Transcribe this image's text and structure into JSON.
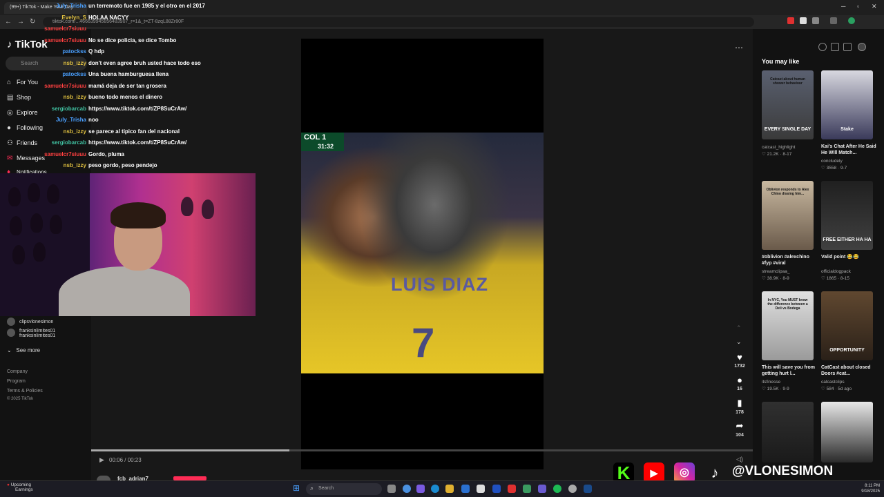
{
  "browser": {
    "tab_title": "(99+) TikTok - Make Your Day",
    "url": "tiktok.com/@...?is_from_webapp=1&sender_device=pc&web_id=7543663994585648390?_r=1&_t=ZT-8zqL8BZr80F",
    "url_short": "tiktok.com/...466639945856483907_r=1&_t=ZT-8zqL88Zr80F"
  },
  "sidebar": {
    "logo": "TikTok",
    "search_placeholder": "Search",
    "nav": [
      {
        "label": "For You"
      },
      {
        "label": "Shop"
      },
      {
        "label": "Explore"
      },
      {
        "label": "Following"
      },
      {
        "label": "Friends"
      },
      {
        "label": "Messages"
      },
      {
        "label": "Notifications"
      }
    ],
    "accounts": [
      {
        "name": "clipsvlonesimon",
        "sub": ""
      },
      {
        "name": "franksinlimites01",
        "sub": "franksinlimites01"
      }
    ],
    "see_more": "See more",
    "footer": [
      "Company",
      "Program",
      "Terms & Policies",
      "© 2025 TikTok"
    ]
  },
  "chat": [
    {
      "user": "July_Trisha",
      "text": "un terremoto fue en 1985 y el otro en el 2017",
      "color": "#4aa0ff"
    },
    {
      "user": "Evelyn_S",
      "text": "HOLAA NACYY",
      "color": "#e0c040"
    },
    {
      "user": "samuelcr7siuuu",
      "text": "",
      "color": "#ff4040"
    },
    {
      "user": "samuelcr7siuuu",
      "text": "No se dice policia, se dice Tombo",
      "color": "#ff4040"
    },
    {
      "user": "patockss",
      "text": "Q hdp",
      "color": "#4aa0ff"
    },
    {
      "user": "nsb_izzy",
      "text": "don't even agree bruh usted hace todo eso",
      "color": "#e0c040"
    },
    {
      "user": "patockss",
      "text": "Una buena hamburguesa llena",
      "color": "#4aa0ff"
    },
    {
      "user": "samuelcr7siuuu",
      "text": "mamá deja de ser tan grosera",
      "color": "#ff4040"
    },
    {
      "user": "nsb_izzy",
      "text": "bueno todo menos el dinero",
      "color": "#e0c040"
    },
    {
      "user": "sergiobarcab",
      "text": "https://www.tiktok.com/t/ZP8SuCrAw/",
      "color": "#40c0a0"
    },
    {
      "user": "July_Trisha",
      "text": "noo",
      "color": "#4aa0ff"
    },
    {
      "user": "nsb_izzy",
      "text": "se parece al tipico fan del nacional",
      "color": "#e0c040"
    },
    {
      "user": "sergiobarcab",
      "text": "https://www.tiktok.com/t/ZP8SuCrAw/",
      "color": "#40c0a0"
    },
    {
      "user": "samuelcr7siuuu",
      "text": "Gordo, pluma",
      "color": "#ff4040"
    },
    {
      "user": "nsb_izzy",
      "text": "peso gordo, peso pendejo",
      "color": "#e0c040"
    }
  ],
  "video": {
    "score_team": "COL 1",
    "score_time": "31:32",
    "jersey_name": "LUIS DIAZ",
    "jersey_number": "7",
    "time": "00:06 / 00:23",
    "progress": 0.3,
    "author": "fcb_adrian7"
  },
  "actions": [
    {
      "icon": "heart-icon",
      "glyph": "♥",
      "count": "1732"
    },
    {
      "icon": "comment-icon",
      "glyph": "●",
      "count": "16"
    },
    {
      "icon": "bookmark-icon",
      "glyph": "▮",
      "count": "178"
    },
    {
      "icon": "share-icon",
      "glyph": "➦",
      "count": "104"
    }
  ],
  "rail": {
    "title": "You may like",
    "cards": [
      {
        "title": "",
        "user": "catcast_highlight",
        "meta": "♡ 21.2K · 8-17",
        "thumb_caption": "EVERY SINGLE DAY",
        "thumb_top": "Catcast about human shower behaviour",
        "c1": "#5a6070",
        "c2": "#3a3a3a"
      },
      {
        "title": "Kai's Chat After He Said He Will Match...",
        "user": "concludely",
        "meta": "♡ 3558 · 9-7",
        "thumb_caption": "Stake",
        "thumb_top": "",
        "c1": "#d8d8e0",
        "c2": "#3a3a5a"
      },
      {
        "title": "#oblivion #alexchino #fyp #viral",
        "user": "streamclipaa_",
        "meta": "♡ 38.9K · 8-9",
        "thumb_caption": "",
        "thumb_top": "Oblivion responds to Alex Chino dissing him...",
        "c1": "#c8b8a0",
        "c2": "#6a5a4a"
      },
      {
        "title": "Valid point 😂😂",
        "user": "officialdogpack",
        "meta": "♡ 1865 · 8-15",
        "thumb_caption": "FREE EITHER HA HA",
        "thumb_top": "",
        "c1": "#202020",
        "c2": "#404040"
      },
      {
        "title": "This will save you from getting hurt l...",
        "user": "itsfinesse",
        "meta": "♡ 19.5K · 9-9",
        "thumb_caption": "",
        "thumb_top": "In NYC, You MUST know the difference between a Deli vs Bodega",
        "c1": "#e0e0e0",
        "c2": "#9a9a9a"
      },
      {
        "title": "CatCast about closed Doors #cat...",
        "user": "catcastclips",
        "meta": "♡ 584 · 5d ago",
        "thumb_caption": "OPPORTUNITY",
        "thumb_top": "",
        "c1": "#604830",
        "c2": "#2a2018"
      },
      {
        "title": "",
        "user": "",
        "meta": "",
        "thumb_caption": "",
        "thumb_top": "",
        "c1": "#303030",
        "c2": "#1a1a1a"
      },
      {
        "title": "",
        "user": "",
        "meta": "",
        "thumb_caption": "",
        "thumb_top": "",
        "c1": "#e8e8e8",
        "c2": "#2a2a2a"
      }
    ]
  },
  "social": {
    "handle": "@VLONESIMON"
  },
  "taskbar": {
    "weather_title": "Upcoming",
    "weather_sub": "Earnings",
    "search": "Search",
    "time": "8:11 PM",
    "date": "9/18/2025"
  }
}
